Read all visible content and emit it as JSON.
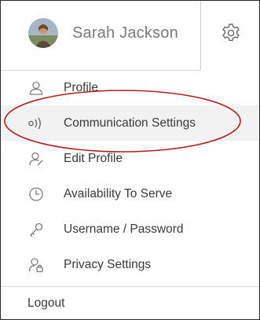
{
  "user": {
    "name": "Sarah Jackson",
    "avatar_icon": "user-avatar"
  },
  "settings_icon": "gear-icon",
  "menu": {
    "items": [
      {
        "label": "Profile",
        "icon": "person-icon"
      },
      {
        "label": "Communication Settings",
        "icon": "broadcast-icon",
        "active": true
      },
      {
        "label": "Edit Profile",
        "icon": "person-edit-icon"
      },
      {
        "label": "Availability To Serve",
        "icon": "clock-icon"
      },
      {
        "label": "Username / Password",
        "icon": "key-icon"
      },
      {
        "label": "Privacy Settings",
        "icon": "person-lock-icon"
      }
    ]
  },
  "logout_label": "Logout",
  "colors": {
    "highlight_ring": "#b02020",
    "active_row": "#f2f2f2",
    "text": "#3a3a3a",
    "icon": "#7d7d7d"
  }
}
